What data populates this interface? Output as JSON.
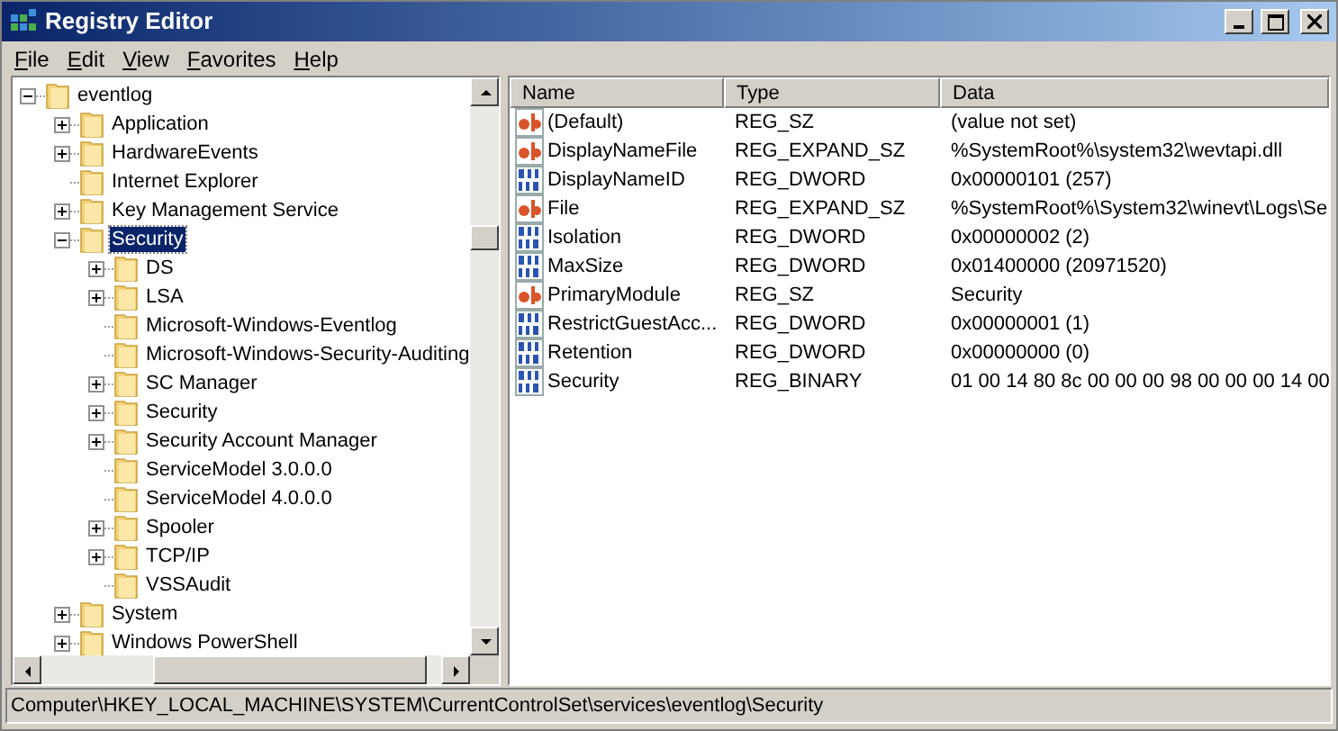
{
  "window": {
    "title": "Registry Editor"
  },
  "menu": [
    "File",
    "Edit",
    "View",
    "Favorites",
    "Help"
  ],
  "tree": [
    {
      "label": "eventlog",
      "kind": "branch",
      "expanded": true,
      "selected": false,
      "children": [
        {
          "label": "Application",
          "kind": "branch",
          "expanded": false,
          "selected": false
        },
        {
          "label": "HardwareEvents",
          "kind": "branch",
          "expanded": false,
          "selected": false
        },
        {
          "label": "Internet Explorer",
          "kind": "leaf",
          "selected": false
        },
        {
          "label": "Key Management Service",
          "kind": "branch",
          "expanded": false,
          "selected": false
        },
        {
          "label": "Security",
          "kind": "branch",
          "expanded": true,
          "selected": true,
          "children": [
            {
              "label": "DS",
              "kind": "branch",
              "expanded": false,
              "selected": false
            },
            {
              "label": "LSA",
              "kind": "branch",
              "expanded": false,
              "selected": false
            },
            {
              "label": "Microsoft-Windows-Eventlog",
              "kind": "leaf",
              "selected": false
            },
            {
              "label": "Microsoft-Windows-Security-Auditing",
              "kind": "leaf",
              "selected": false
            },
            {
              "label": "SC Manager",
              "kind": "branch",
              "expanded": false,
              "selected": false
            },
            {
              "label": "Security",
              "kind": "branch",
              "expanded": false,
              "selected": false
            },
            {
              "label": "Security Account Manager",
              "kind": "branch",
              "expanded": false,
              "selected": false
            },
            {
              "label": "ServiceModel 3.0.0.0",
              "kind": "leaf",
              "selected": false
            },
            {
              "label": "ServiceModel 4.0.0.0",
              "kind": "leaf",
              "selected": false
            },
            {
              "label": "Spooler",
              "kind": "branch",
              "expanded": false,
              "selected": false
            },
            {
              "label": "TCP/IP",
              "kind": "branch",
              "expanded": false,
              "selected": false
            },
            {
              "label": "VSSAudit",
              "kind": "leaf",
              "selected": false
            }
          ]
        },
        {
          "label": "System",
          "kind": "branch",
          "expanded": false,
          "selected": false
        },
        {
          "label": "Windows PowerShell",
          "kind": "branch",
          "expanded": false,
          "selected": false
        }
      ]
    }
  ],
  "table": {
    "columns": [
      "Name",
      "Type",
      "Data"
    ],
    "rows": [
      {
        "kind": "string",
        "name": "(Default)",
        "type": "REG_SZ",
        "data": "(value not set)"
      },
      {
        "kind": "string",
        "name": "DisplayNameFile",
        "type": "REG_EXPAND_SZ",
        "data": "%SystemRoot%\\system32\\wevtapi.dll"
      },
      {
        "kind": "binary",
        "name": "DisplayNameID",
        "type": "REG_DWORD",
        "data": "0x00000101 (257)"
      },
      {
        "kind": "string",
        "name": "File",
        "type": "REG_EXPAND_SZ",
        "data": "%SystemRoot%\\System32\\winevt\\Logs\\Se"
      },
      {
        "kind": "binary",
        "name": "Isolation",
        "type": "REG_DWORD",
        "data": "0x00000002 (2)"
      },
      {
        "kind": "binary",
        "name": "MaxSize",
        "type": "REG_DWORD",
        "data": "0x01400000 (20971520)"
      },
      {
        "kind": "string",
        "name": "PrimaryModule",
        "type": "REG_SZ",
        "data": "Security"
      },
      {
        "kind": "binary",
        "name": "RestrictGuestAcc...",
        "type": "REG_DWORD",
        "data": "0x00000001 (1)"
      },
      {
        "kind": "binary",
        "name": "Retention",
        "type": "REG_DWORD",
        "data": "0x00000000 (0)"
      },
      {
        "kind": "binary",
        "name": "Security",
        "type": "REG_BINARY",
        "data": "01 00 14 80 8c 00 00 00 98 00 00 00 14 00"
      }
    ]
  },
  "status_bar": "Computer\\HKEY_LOCAL_MACHINE\\SYSTEM\\CurrentControlSet\\services\\eventlog\\Security"
}
